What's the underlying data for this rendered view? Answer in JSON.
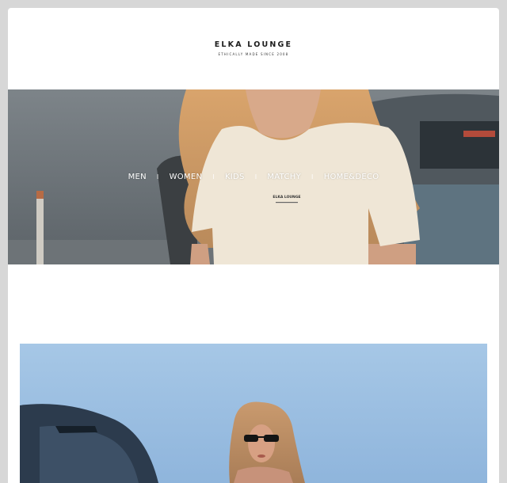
{
  "header": {
    "brand": "ELKA LOUNGE",
    "tagline": "ETHICALLY MADE SINCE 2008"
  },
  "hero": {
    "shirt_print": "ELKA LOUNGE",
    "image": "woman in cream t-shirt sitting by a car"
  },
  "nav": {
    "items": [
      {
        "label": "MEN"
      },
      {
        "label": "WOMEN"
      },
      {
        "label": "KIDS"
      },
      {
        "label": "MATCHY"
      },
      {
        "label": "HOME&DECO"
      }
    ],
    "separator": "I"
  },
  "feature": {
    "image": "woman in sunglasses beside a car under blue sky"
  },
  "colors": {
    "page_bg": "#d7d7d7",
    "card_bg": "#ffffff",
    "nav_text": "#ffffff",
    "sky": "#9cbfe0"
  }
}
